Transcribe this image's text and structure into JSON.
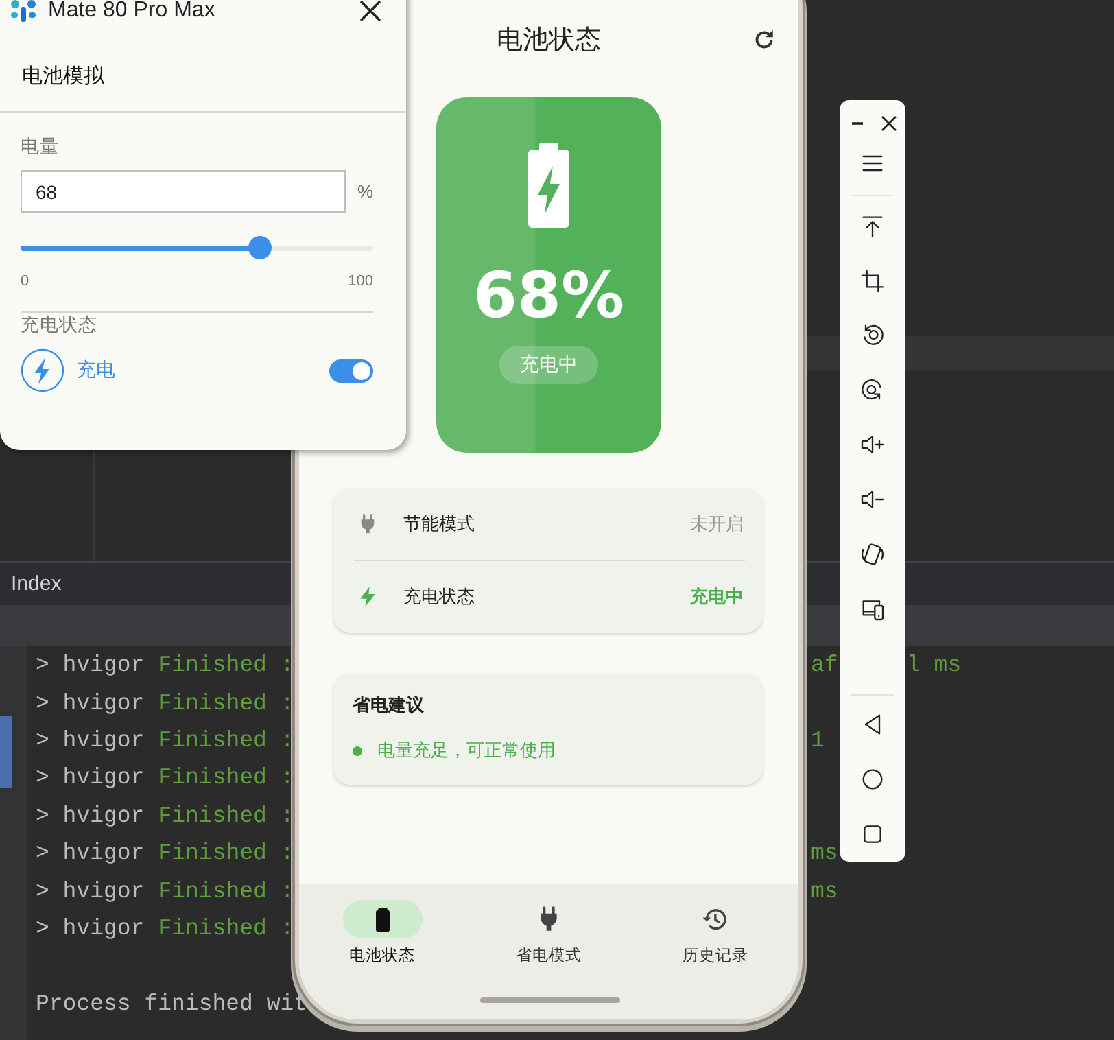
{
  "ide": {
    "panel_title": "Index",
    "console": [
      {
        "source": "> hvigor",
        "message": "Finished :",
        "tail": "af",
        "far": "l ms"
      },
      {
        "source": "> hvigor",
        "message": "Finished :"
      },
      {
        "source": "> hvigor",
        "message": "Finished :",
        "tail": "1"
      },
      {
        "source": "> hvigor",
        "message": "Finished :"
      },
      {
        "source": "> hvigor",
        "message": "Finished :"
      },
      {
        "source": "> hvigor",
        "message": "Finished :",
        "tail": "ms"
      },
      {
        "source": "> hvigor",
        "message": "Finished :",
        "tail": "ms"
      },
      {
        "source": "> hvigor",
        "message": "Finished :"
      }
    ],
    "process_line": "Process finished wit"
  },
  "simulator": {
    "device": "Mate 80 Pro Max",
    "section": "电池模拟",
    "level_label": "电量",
    "level_value": "68",
    "unit": "%",
    "level": 0.68,
    "min": "0",
    "max": "100",
    "charge_label": "充电状态",
    "charge_option": "充电",
    "charging_on": true
  },
  "phone": {
    "title": "电池状态",
    "battery": {
      "percent": "68%",
      "status": "充电中",
      "charging": true
    },
    "info_rows": [
      {
        "kind": "plug",
        "label": "节能模式",
        "value": "未开启",
        "active": false
      },
      {
        "kind": "bolt",
        "label": "充电状态",
        "value": "充电中",
        "active": true
      }
    ],
    "tips": {
      "title": "省电建议",
      "items": [
        "电量充足，可正常使用"
      ]
    },
    "nav": [
      {
        "kind": "battery",
        "label": "电池状态",
        "selected": true
      },
      {
        "kind": "plug",
        "label": "省电模式",
        "selected": false
      },
      {
        "kind": "history",
        "label": "历史记录",
        "selected": false
      }
    ]
  },
  "toolbar": {
    "items": [
      {
        "kind": "menu"
      },
      {
        "kind": "divider"
      },
      {
        "kind": "pin_top"
      },
      {
        "kind": "crop"
      },
      {
        "kind": "rotate_left"
      },
      {
        "kind": "rotate_right"
      },
      {
        "kind": "volume_up"
      },
      {
        "kind": "volume_down"
      },
      {
        "kind": "shake"
      },
      {
        "kind": "multi_device"
      },
      {
        "kind": "spacer"
      },
      {
        "kind": "divider"
      },
      {
        "kind": "back"
      },
      {
        "kind": "home"
      },
      {
        "kind": "recents"
      }
    ]
  }
}
